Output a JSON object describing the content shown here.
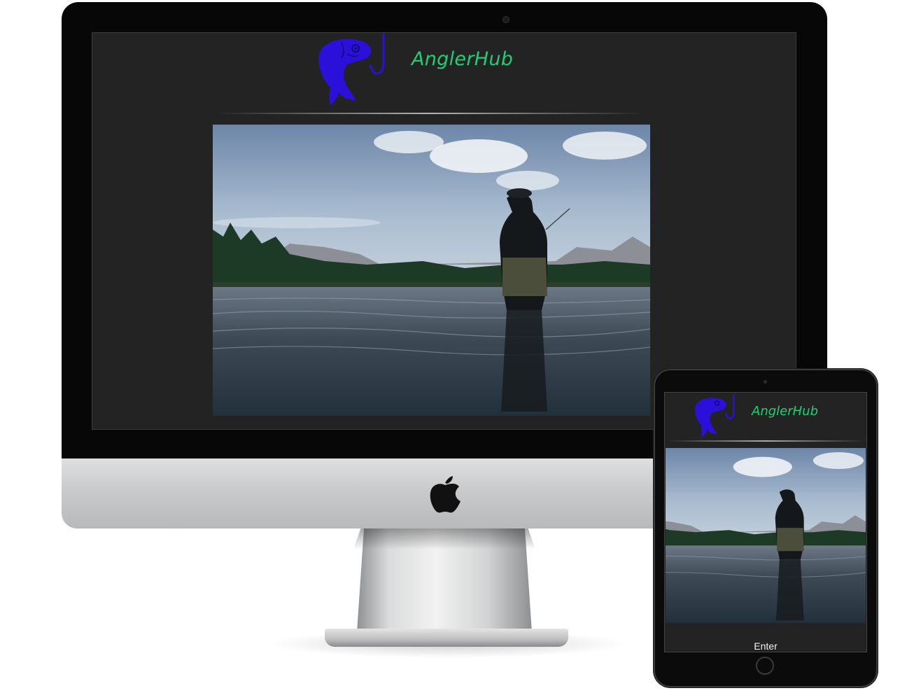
{
  "site": {
    "brand": "AnglerHub",
    "enter_label": "Enter"
  },
  "colors": {
    "brand_text": "#1fcf73",
    "logo_fish": "#2a10d8",
    "background": "#232323"
  },
  "icons": {
    "logo": "fish-hook-icon",
    "device_logo": "apple-logo-icon"
  }
}
